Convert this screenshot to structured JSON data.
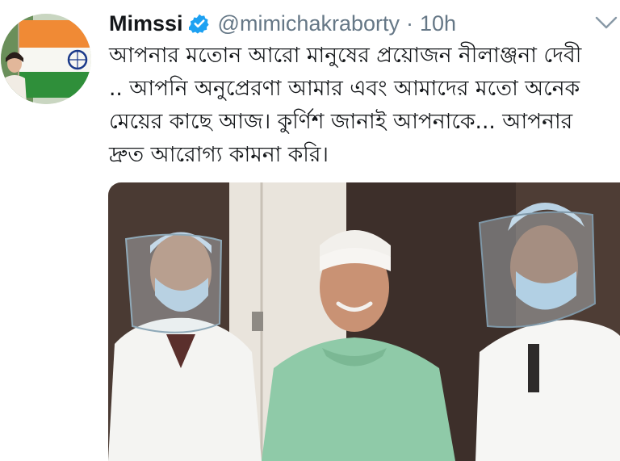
{
  "tweet": {
    "display_name": "Mimssi",
    "handle": "@mimichakraborty",
    "separator": "·",
    "time": "10h",
    "text": "আপনার মতোন আরো মানুষের প্রয়োজন নীলাঞ্জনা দেবী .. আপনি অনুপ্রেরণা আমার এবং আমাদের মতো অনেক মেয়ের কাছে আজ। কুর্ণিশ জানাই আপনাকে... আপনার দ্রুত আরোগ্য কামনা করি।",
    "verified": true
  },
  "icons": {
    "verified": "verified-badge-icon",
    "menu": "chevron-down-icon"
  },
  "colors": {
    "verified_blue": "#1da1f2",
    "secondary_text": "#657786",
    "primary_text": "#14171a"
  }
}
